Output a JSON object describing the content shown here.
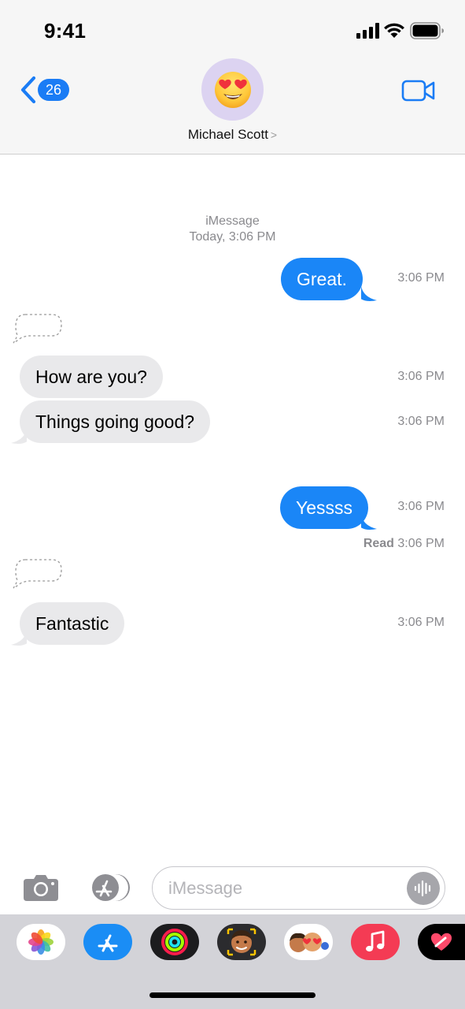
{
  "status_bar": {
    "time": "9:41"
  },
  "header": {
    "back_badge_count": "26",
    "contact_name": "Michael Scott",
    "name_chevron": ">",
    "avatar_emoji": "😍"
  },
  "thread": {
    "service": "iMessage",
    "date_line": "Today, 3:06 PM"
  },
  "messages": [
    {
      "direction": "sent",
      "text": "Great.",
      "time": "3:06 PM"
    },
    {
      "direction": "received",
      "text": "How are you?",
      "time": "3:06 PM"
    },
    {
      "direction": "received",
      "text": "Things going good?",
      "time": "3:06 PM"
    },
    {
      "direction": "sent",
      "text": "Yessss",
      "time": "3:06 PM"
    },
    {
      "direction": "received",
      "text": "Fantastic",
      "time": "3:06 PM"
    }
  ],
  "read_receipt": {
    "label": "Read",
    "time": "3:06 PM"
  },
  "composer": {
    "placeholder": "iMessage"
  },
  "app_drawer": {
    "apps": [
      "photos-app",
      "app-store-app",
      "activity-app",
      "memoji-app",
      "animoji-stickers-app",
      "music-app",
      "digital-touch-app"
    ]
  },
  "colors": {
    "sent_bubble": "#1a86f7",
    "received_bubble": "#e9e9eb",
    "accent": "#1a7cf5",
    "secondary_text": "#8a8a8e"
  }
}
